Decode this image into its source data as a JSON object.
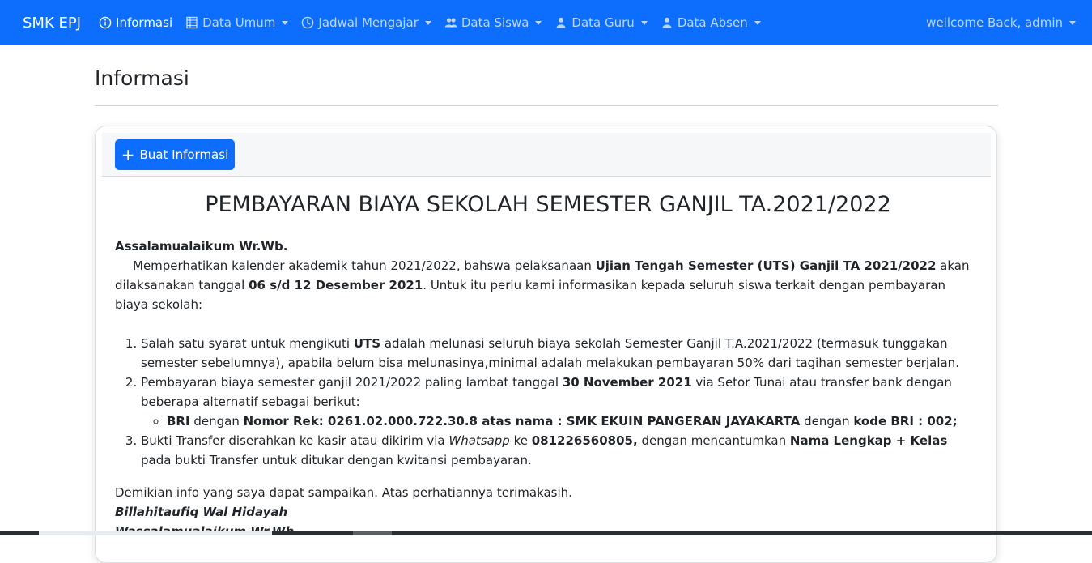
{
  "navbar": {
    "brand": "SMK EPJ",
    "items": [
      {
        "label": "Informasi",
        "icon": "info-circle-icon",
        "active": true
      },
      {
        "label": "Data Umum",
        "icon": "table-icon",
        "dropdown": true
      },
      {
        "label": "Jadwal Mengajar",
        "icon": "clock-icon",
        "dropdown": true
      },
      {
        "label": "Data Siswa",
        "icon": "people-icon",
        "dropdown": true
      },
      {
        "label": "Data Guru",
        "icon": "person-icon",
        "dropdown": true
      },
      {
        "label": "Data Absen",
        "icon": "person-icon",
        "dropdown": true
      }
    ],
    "user_label": "wellcome Back, admin"
  },
  "page": {
    "title": "Informasi"
  },
  "card": {
    "create_button": "Buat Informasi",
    "info_title": "PEMBAYARAN BIAYA SEKOLAH SEMESTER GANJIL TA.2021/2022",
    "greeting": "Assalamualaikum Wr.Wb.",
    "intro": {
      "t1": "Memperhatikan kalender akademik tahun 2021/2022, bahswa pelaksanaan ",
      "b1": "Ujian Tengah Semester (UTS) Ganjil TA 2021/2022",
      "t2": " akan dilaksanakan tanggal ",
      "b2": "06 s/d 12 Desember 2021",
      "t3": ". Untuk itu perlu kami informasikan kepada seluruh siswa terkait dengan pembayaran biaya sekolah:"
    },
    "item1": {
      "t1": "Salah satu syarat untuk mengikuti ",
      "b1": "UTS",
      "t2": " adalah melunasi seluruh biaya sekolah Semester Ganjil T.A.2021/2022 (termasuk tunggakan semester sebelumnya), apabila belum bisa melunasinya,minimal adalah melakukan pembayaran 50% dari tagihan semester berjalan."
    },
    "item2": {
      "t1": "Pembayaran biaya semester ganjil 2021/2022 paling lambat tanggal ",
      "b1": "30 November 2021",
      "t2": " via Setor Tunai atau transfer bank dengan beberapa alternatif sebagai berikut:",
      "sub": {
        "b1": "BRI",
        "t1": " dengan ",
        "b2": "Nomor Rek: 0261.02.000.722.30.8 atas nama : SMK EKUIN PANGERAN JAYAKARTA",
        "t2": " dengan ",
        "b3": "kode BRI : 002;"
      }
    },
    "item3": {
      "t1": "Bukti Transfer diserahkan ke kasir atau dikirim via ",
      "i1": "Whatsapp",
      "t2": " ke ",
      "b1": "081226560805,",
      "t3": " dengan mencantumkan ",
      "b2": "Nama Lengkap + Kelas",
      "t4": " pada bukti Transfer untuk ditukar dengan kwitansi pembayaran."
    },
    "closing": "Demikian info yang saya dapat sampaikan. Atas perhatiannya terimakasih.",
    "sign1": "Billahitaufiq Wal Hidayah",
    "sign2": "Wassalamualaikum Wr.Wb"
  },
  "colors": {
    "navbar": "#0d6efd",
    "primary_button": "#0d6efd"
  }
}
